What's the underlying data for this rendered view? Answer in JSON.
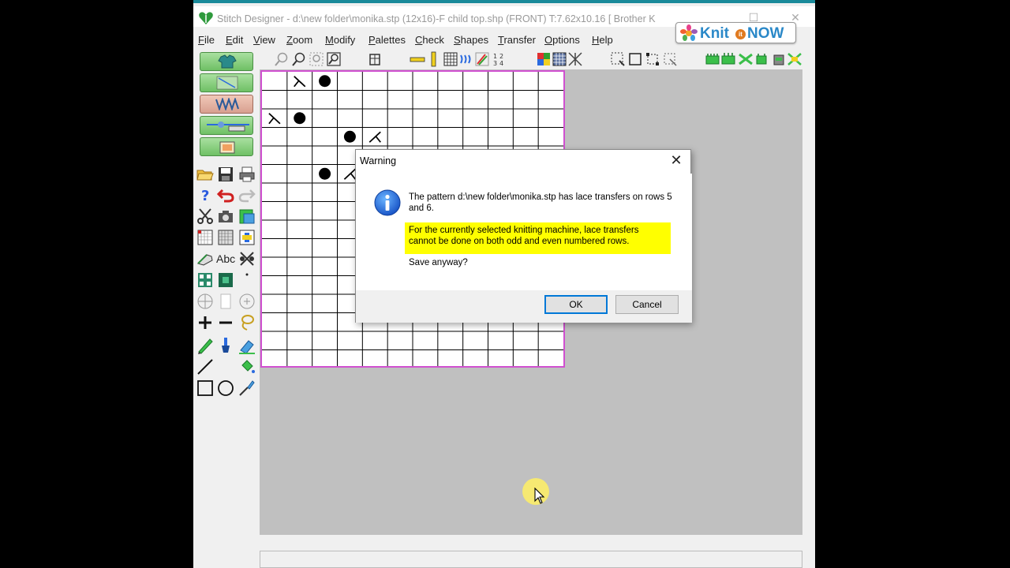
{
  "window": {
    "title": "Stitch Designer - d:\\new folder\\monika.stp (12x16)-F     child top.shp (FRONT)     T:7.62x10.16     [ Brother K"
  },
  "logo": {
    "text_knit": "Knit",
    "text_it": "it",
    "text_now": "NOW"
  },
  "menu": [
    {
      "first": "F",
      "rest": "ile"
    },
    {
      "first": "E",
      "rest": "dit"
    },
    {
      "first": "V",
      "rest": "iew"
    },
    {
      "first": "Z",
      "rest": "oom"
    },
    {
      "first": "M",
      "rest": "odify"
    },
    {
      "first": "P",
      "rest": "alettes"
    },
    {
      "first": "C",
      "rest": "heck"
    },
    {
      "first": "S",
      "rest": "hapes"
    },
    {
      "first": "T",
      "rest": "ransfer"
    },
    {
      "first": "O",
      "rest": "ptions"
    },
    {
      "first": "H",
      "rest": "elp"
    }
  ],
  "sidebar": {
    "text_tool_label": "Abc"
  },
  "grid": {
    "cols": 12,
    "rows": 16,
    "stitches": [
      {
        "row": 1,
        "col": 2,
        "type": "left-lean"
      },
      {
        "row": 1,
        "col": 3,
        "type": "hole"
      },
      {
        "row": 3,
        "col": 1,
        "type": "left-lean"
      },
      {
        "row": 3,
        "col": 2,
        "type": "hole"
      },
      {
        "row": 4,
        "col": 4,
        "type": "hole"
      },
      {
        "row": 4,
        "col": 5,
        "type": "right-lean"
      },
      {
        "row": 6,
        "col": 3,
        "type": "hole"
      },
      {
        "row": 6,
        "col": 4,
        "type": "right-lean"
      }
    ]
  },
  "dialog": {
    "title": "Warning",
    "message_line": "The pattern d:\\new folder\\monika.stp has lace transfers on rows 5 and 6.",
    "highlight_message": "For the currently selected knitting machine, lace transfers cannot be done on both odd and even numbered rows.",
    "question": "Save anyway?",
    "ok_label": "OK",
    "cancel_label": "Cancel",
    "close_glyph": "✕",
    "highlight_color": "#ffff00"
  }
}
